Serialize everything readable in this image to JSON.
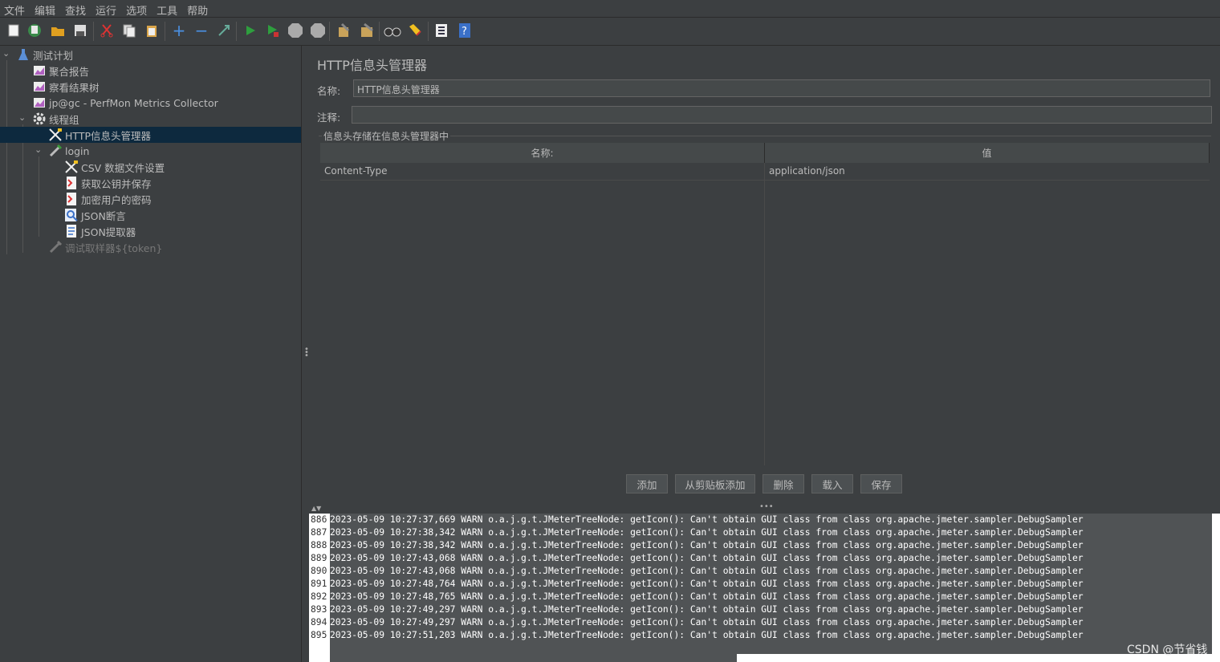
{
  "menu": [
    "文件",
    "编辑",
    "查找",
    "运行",
    "选项",
    "工具",
    "帮助"
  ],
  "toolbar_icons": [
    "new-icon",
    "templates-icon",
    "open-icon",
    "save-icon",
    "cut-icon",
    "copy-icon",
    "paste-icon",
    "expand-icon",
    "collapse-icon",
    "toggle-icon",
    "start-icon",
    "start-no-pause-icon",
    "stop-icon",
    "shutdown-icon",
    "clear-icon",
    "clear-all-icon",
    "search-icon",
    "reset-search-icon",
    "function-helper-icon",
    "help-icon"
  ],
  "tree": {
    "test_plan": "测试计划",
    "aggregate_report": "聚合报告",
    "results_tree": "察看结果树",
    "perfmon": "jp@gc - PerfMon Metrics Collector",
    "thread_group": "线程组",
    "header_manager": "HTTP信息头管理器",
    "login": "login",
    "csv": "CSV 数据文件设置",
    "get_key": "获取公钥并保存",
    "encrypt": "加密用户的密码",
    "json_assert": "JSON断言",
    "json_extract": "JSON提取器",
    "debug": "调试取样器${token}"
  },
  "editor": {
    "title": "HTTP信息头管理器",
    "name_label": "名称:",
    "name_value": "HTTP信息头管理器",
    "comment_label": "注释:",
    "comment_value": "",
    "group_title": "信息头存储在信息头管理器中",
    "col_name": "名称:",
    "col_value": "值",
    "rows": [
      {
        "name": "Content-Type",
        "value": "application/json"
      }
    ],
    "buttons": [
      "添加",
      "从剪贴板添加",
      "删除",
      "载入",
      "保存"
    ]
  },
  "log": [
    {
      "n": "886",
      "text": "2023-05-09 10:27:37,669 WARN o.a.j.g.t.JMeterTreeNode: getIcon(): Can't obtain GUI class from class org.apache.jmeter.sampler.DebugSampler"
    },
    {
      "n": "887",
      "text": "2023-05-09 10:27:38,342 WARN o.a.j.g.t.JMeterTreeNode: getIcon(): Can't obtain GUI class from class org.apache.jmeter.sampler.DebugSampler"
    },
    {
      "n": "888",
      "text": "2023-05-09 10:27:38,342 WARN o.a.j.g.t.JMeterTreeNode: getIcon(): Can't obtain GUI class from class org.apache.jmeter.sampler.DebugSampler"
    },
    {
      "n": "889",
      "text": "2023-05-09 10:27:43,068 WARN o.a.j.g.t.JMeterTreeNode: getIcon(): Can't obtain GUI class from class org.apache.jmeter.sampler.DebugSampler"
    },
    {
      "n": "890",
      "text": "2023-05-09 10:27:43,068 WARN o.a.j.g.t.JMeterTreeNode: getIcon(): Can't obtain GUI class from class org.apache.jmeter.sampler.DebugSampler"
    },
    {
      "n": "891",
      "text": "2023-05-09 10:27:48,764 WARN o.a.j.g.t.JMeterTreeNode: getIcon(): Can't obtain GUI class from class org.apache.jmeter.sampler.DebugSampler"
    },
    {
      "n": "892",
      "text": "2023-05-09 10:27:48,765 WARN o.a.j.g.t.JMeterTreeNode: getIcon(): Can't obtain GUI class from class org.apache.jmeter.sampler.DebugSampler"
    },
    {
      "n": "893",
      "text": "2023-05-09 10:27:49,297 WARN o.a.j.g.t.JMeterTreeNode: getIcon(): Can't obtain GUI class from class org.apache.jmeter.sampler.DebugSampler"
    },
    {
      "n": "894",
      "text": "2023-05-09 10:27:49,297 WARN o.a.j.g.t.JMeterTreeNode: getIcon(): Can't obtain GUI class from class org.apache.jmeter.sampler.DebugSampler"
    },
    {
      "n": "895",
      "text": "2023-05-09 10:27:51,203 WARN o.a.j.g.t.JMeterTreeNode: getIcon(): Can't obtain GUI class from class org.apache.jmeter.sampler.DebugSampler"
    }
  ],
  "watermark": "CSDN @节省钱"
}
